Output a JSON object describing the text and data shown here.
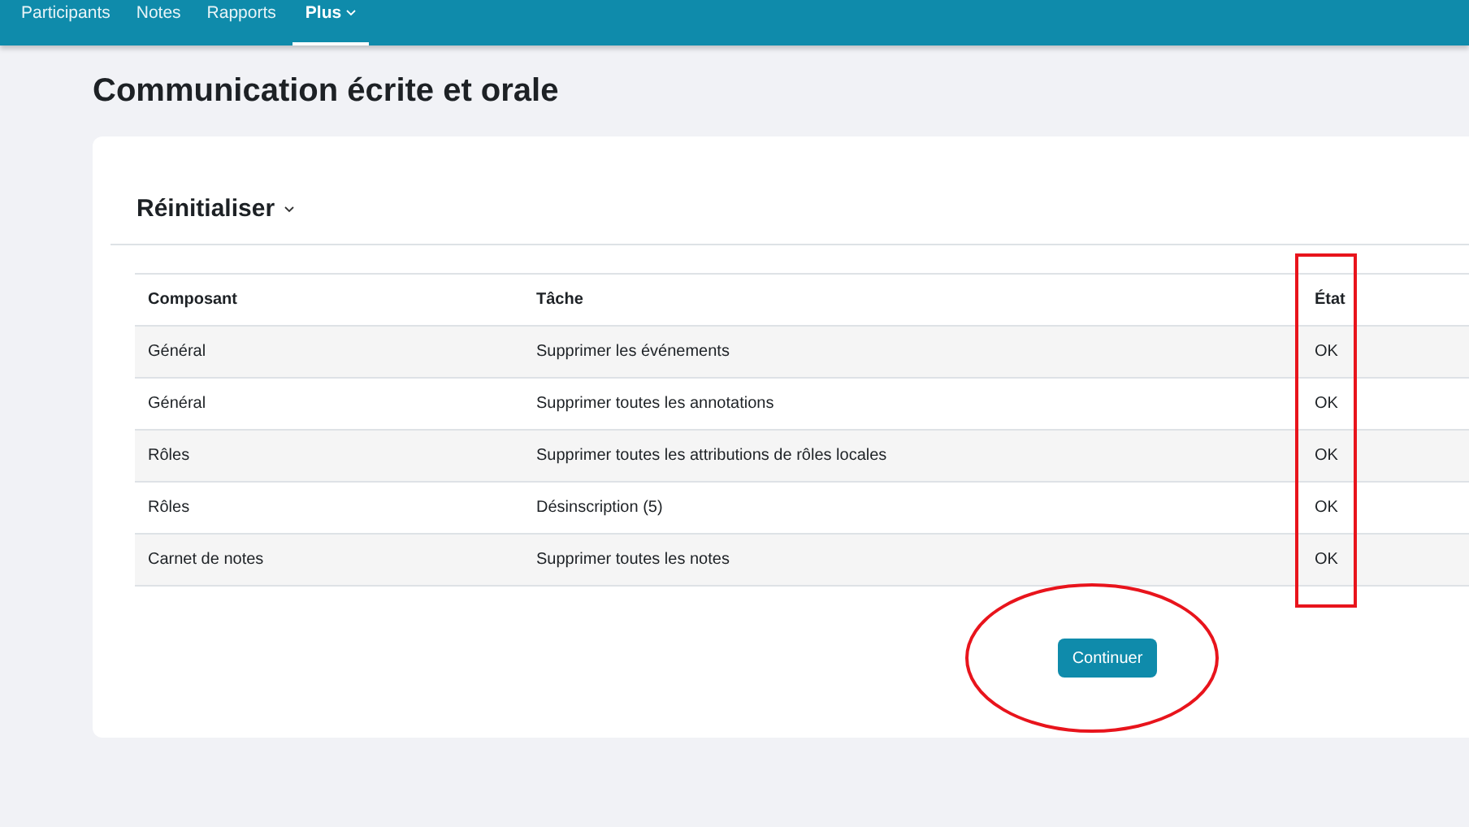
{
  "nav": {
    "tabs": [
      {
        "label": "Participants",
        "selected": false
      },
      {
        "label": "Notes",
        "selected": false
      },
      {
        "label": "Rapports",
        "selected": false
      },
      {
        "label": "Plus",
        "selected": true,
        "dropdown": true
      }
    ]
  },
  "page_title": "Communication écrite et orale",
  "section": {
    "title": "Réinitialiser",
    "dropdown": true
  },
  "table": {
    "columns": [
      "Composant",
      "Tâche",
      "État"
    ],
    "rows": [
      [
        "Général",
        "Supprimer les événements",
        "OK"
      ],
      [
        "Général",
        "Supprimer toutes les annotations",
        "OK"
      ],
      [
        "Rôles",
        "Supprimer toutes les attributions de rôles locales",
        "OK"
      ],
      [
        "Rôles",
        "Désinscription (5)",
        "OK"
      ],
      [
        "Carnet de notes",
        "Supprimer toutes les notes",
        "OK"
      ]
    ]
  },
  "button": "Continuer"
}
